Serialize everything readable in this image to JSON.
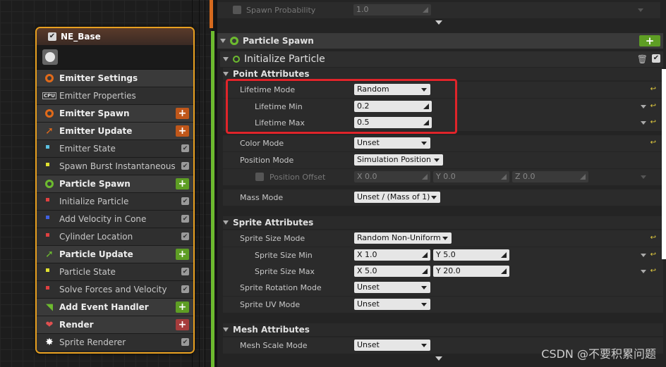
{
  "node": {
    "title": "NE_Base",
    "rows": [
      {
        "label": "Emitter Settings",
        "kind": "sec",
        "icon": "emitter-settings-icon",
        "icon_color": "#e06a1a",
        "btn": ""
      },
      {
        "label": "Emitter Properties",
        "kind": "mod",
        "icon": "cpu-icon",
        "icon_color": "#dddddd",
        "btn": ""
      },
      {
        "label": "Emitter Spawn",
        "kind": "sec",
        "icon": "emitter-spawn-icon",
        "icon_color": "#e06a1a",
        "btn": "orange"
      },
      {
        "label": "Emitter Update",
        "kind": "sec",
        "icon": "emitter-update-icon",
        "icon_color": "#e06a1a",
        "btn": "orange"
      },
      {
        "label": "Emitter State",
        "kind": "mod",
        "icon": "module-dots-icon",
        "icon_color": "#5bc0e0",
        "btn": "check"
      },
      {
        "label": "Spawn Burst Instantaneous",
        "kind": "mod",
        "icon": "module-dots-icon",
        "icon_color": "#e0e030",
        "btn": "check"
      },
      {
        "label": "Particle Spawn",
        "kind": "sec",
        "icon": "particle-spawn-icon",
        "icon_color": "#6dbb2f",
        "btn": "green"
      },
      {
        "label": "Initialize Particle",
        "kind": "mod",
        "icon": "module-dots-icon",
        "icon_color": "#e04040",
        "btn": "check"
      },
      {
        "label": "Add Velocity in Cone",
        "kind": "mod",
        "icon": "module-dots-icon",
        "icon_color": "#4060e0",
        "btn": "check"
      },
      {
        "label": "Cylinder Location",
        "kind": "mod",
        "icon": "module-dots-icon",
        "icon_color": "#e04040",
        "btn": "check"
      },
      {
        "label": "Particle Update",
        "kind": "sec",
        "icon": "particle-update-icon",
        "icon_color": "#6dbb2f",
        "btn": "green"
      },
      {
        "label": "Particle State",
        "kind": "mod",
        "icon": "module-dots-icon",
        "icon_color": "#e0e030",
        "btn": "check"
      },
      {
        "label": "Solve Forces and Velocity",
        "kind": "mod",
        "icon": "module-dots-icon",
        "icon_color": "#e04040",
        "btn": "check"
      },
      {
        "label": "Add Event Handler",
        "kind": "sec",
        "icon": "event-handler-icon",
        "icon_color": "#6dbb2f",
        "btn": "green"
      },
      {
        "label": "Render",
        "kind": "sec",
        "icon": "render-icon",
        "icon_color": "#e05050",
        "btn": "red"
      },
      {
        "label": "Sprite Renderer",
        "kind": "mod",
        "icon": "sprite-renderer-icon",
        "icon_color": "#ffffff",
        "btn": "check"
      }
    ]
  },
  "panel": {
    "spawn_probability_label": "Spawn Probability",
    "spawn_probability_value": "1.0",
    "particle_spawn_header": "Particle Spawn",
    "initialize_particle_header": "Initialize Particle",
    "point_attributes": "Point Attributes",
    "lifetime_mode_label": "Lifetime Mode",
    "lifetime_mode_value": "Random",
    "lifetime_min_label": "Lifetime Min",
    "lifetime_min_value": "0.2",
    "lifetime_max_label": "Lifetime Max",
    "lifetime_max_value": "0.5",
    "color_mode_label": "Color Mode",
    "color_mode_value": "Unset",
    "position_mode_label": "Position Mode",
    "position_mode_value": "Simulation Position",
    "position_offset_label": "Position Offset",
    "position_offset_x": "X 0.0",
    "position_offset_y": "Y 0.0",
    "position_offset_z": "Z 0.0",
    "mass_mode_label": "Mass Mode",
    "mass_mode_value": "Unset / (Mass of 1)",
    "sprite_attributes": "Sprite Attributes",
    "sprite_size_mode_label": "Sprite Size Mode",
    "sprite_size_mode_value": "Random Non-Uniform",
    "sprite_size_min_label": "Sprite Size Min",
    "sprite_size_min_x": "X 1.0",
    "sprite_size_min_y": "Y 5.0",
    "sprite_size_max_label": "Sprite Size Max",
    "sprite_size_max_x": "X 5.0",
    "sprite_size_max_y": "Y 20.0",
    "sprite_rotation_mode_label": "Sprite Rotation Mode",
    "sprite_rotation_mode_value": "Unset",
    "sprite_uv_mode_label": "Sprite UV Mode",
    "sprite_uv_mode_value": "Unset",
    "mesh_attributes": "Mesh Attributes",
    "mesh_scale_mode_label": "Mesh Scale Mode",
    "mesh_scale_mode_value": "Unset"
  },
  "watermark": "CSDN @不要积累问题"
}
